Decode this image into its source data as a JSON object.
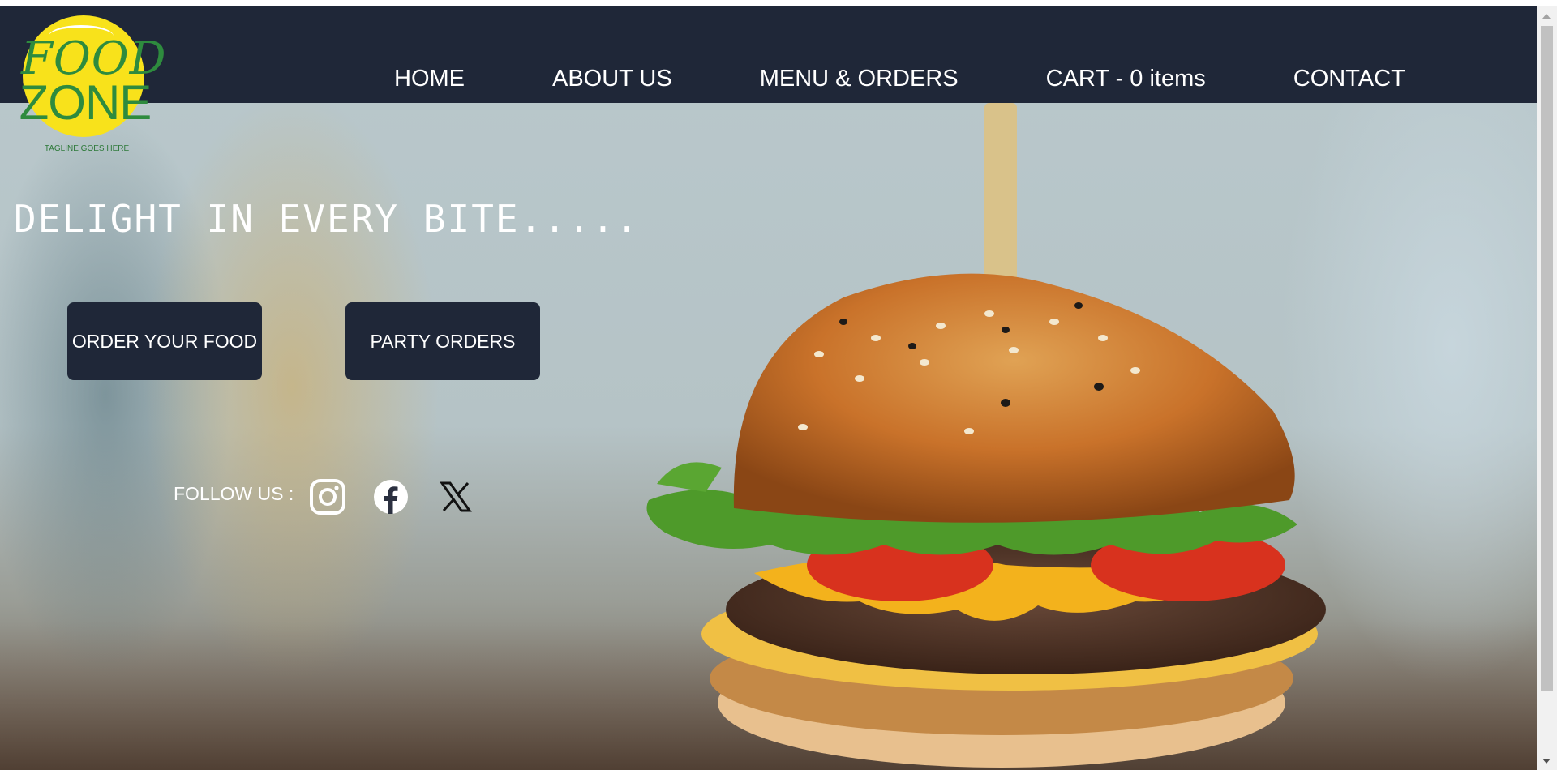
{
  "logo": {
    "word1": "FOOD",
    "word2": "ZONE",
    "tagline": "TAGLINE GOES HERE"
  },
  "nav": {
    "items": [
      {
        "label": "HOME"
      },
      {
        "label": "ABOUT US"
      },
      {
        "label": "MENU & ORDERS"
      },
      {
        "label": "CART - 0 items"
      },
      {
        "label": "CONTACT"
      }
    ]
  },
  "hero": {
    "title": "DELIGHT IN EVERY BITE.....",
    "order_button": "ORDER YOUR FOOD",
    "party_button": "PARTY ORDERS"
  },
  "social": {
    "follow_label": "FOLLOW US :",
    "icons": [
      "instagram-icon",
      "facebook-icon",
      "x-icon"
    ]
  },
  "colors": {
    "navbar": "#1f2738",
    "logo_yellow": "#f8e21b",
    "logo_green": "#2e8b3e",
    "text": "#ffffff"
  }
}
